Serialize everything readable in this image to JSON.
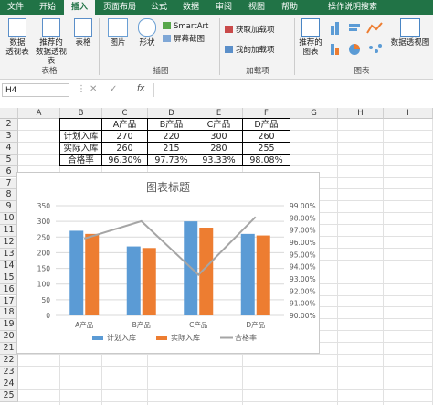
{
  "ribbon_tabs": [
    "文件",
    "开始",
    "插入",
    "页面布局",
    "公式",
    "数据",
    "审阅",
    "视图",
    "帮助",
    "操作说明搜索"
  ],
  "active_tab": "插入",
  "ribbon": {
    "pivot_table": "数据\n透视表",
    "recommended_pivot": "推荐的\n数据透视表",
    "table": "表格",
    "group_tables": "表格",
    "pictures": "图片",
    "shapes": "形状",
    "smartart": "SmartArt",
    "screenshot": "屏幕截图",
    "group_illustrations": "插图",
    "get_addins": "获取加载项",
    "my_addins": "我的加载项",
    "group_addins": "加载项",
    "recommended_charts": "推荐的\n图表",
    "pivot_chart": "数据透视图",
    "group_charts": "图表"
  },
  "formula_bar": {
    "name_box": "H4",
    "fx": "fx",
    "formula": ""
  },
  "columns": [
    "A",
    "B",
    "C",
    "D",
    "E",
    "F",
    "G",
    "H",
    "I"
  ],
  "rows": [
    "2",
    "3",
    "4",
    "5",
    "6",
    "7",
    "8",
    "9",
    "10",
    "11",
    "12",
    "13",
    "14",
    "15",
    "16",
    "17",
    "18",
    "19",
    "20",
    "21",
    "22",
    "23",
    "24",
    "25"
  ],
  "table": {
    "header": [
      "",
      "A产品",
      "B产品",
      "C产品",
      "D产品"
    ],
    "rows": [
      [
        "计划入库",
        "270",
        "220",
        "300",
        "260"
      ],
      [
        "实际入库",
        "260",
        "215",
        "280",
        "255"
      ],
      [
        "合格率",
        "96.30%",
        "97.73%",
        "93.33%",
        "98.08%"
      ]
    ]
  },
  "chart_data": {
    "type": "bar",
    "title": "图表标题",
    "categories": [
      "A产品",
      "B产品",
      "C产品",
      "D产品"
    ],
    "series": [
      {
        "name": "计划入库",
        "type": "bar",
        "axis": "left",
        "values": [
          270,
          220,
          300,
          260
        ],
        "color": "#5b9bd5"
      },
      {
        "name": "实际入库",
        "type": "bar",
        "axis": "left",
        "values": [
          260,
          215,
          280,
          255
        ],
        "color": "#ed7d31"
      },
      {
        "name": "合格率",
        "type": "line",
        "axis": "right",
        "values": [
          0.963,
          0.9773,
          0.9333,
          0.9808
        ],
        "color": "#a5a5a5"
      }
    ],
    "ylim": [
      0,
      350
    ],
    "yticks": [
      0,
      50,
      100,
      150,
      200,
      250,
      300,
      350
    ],
    "y2lim": [
      0.9,
      0.99
    ],
    "y2ticks": [
      "90.00%",
      "91.00%",
      "92.00%",
      "93.00%",
      "94.00%",
      "95.00%",
      "96.00%",
      "97.00%",
      "98.00%",
      "99.00%"
    ],
    "grid": true,
    "legend_position": "bottom"
  }
}
